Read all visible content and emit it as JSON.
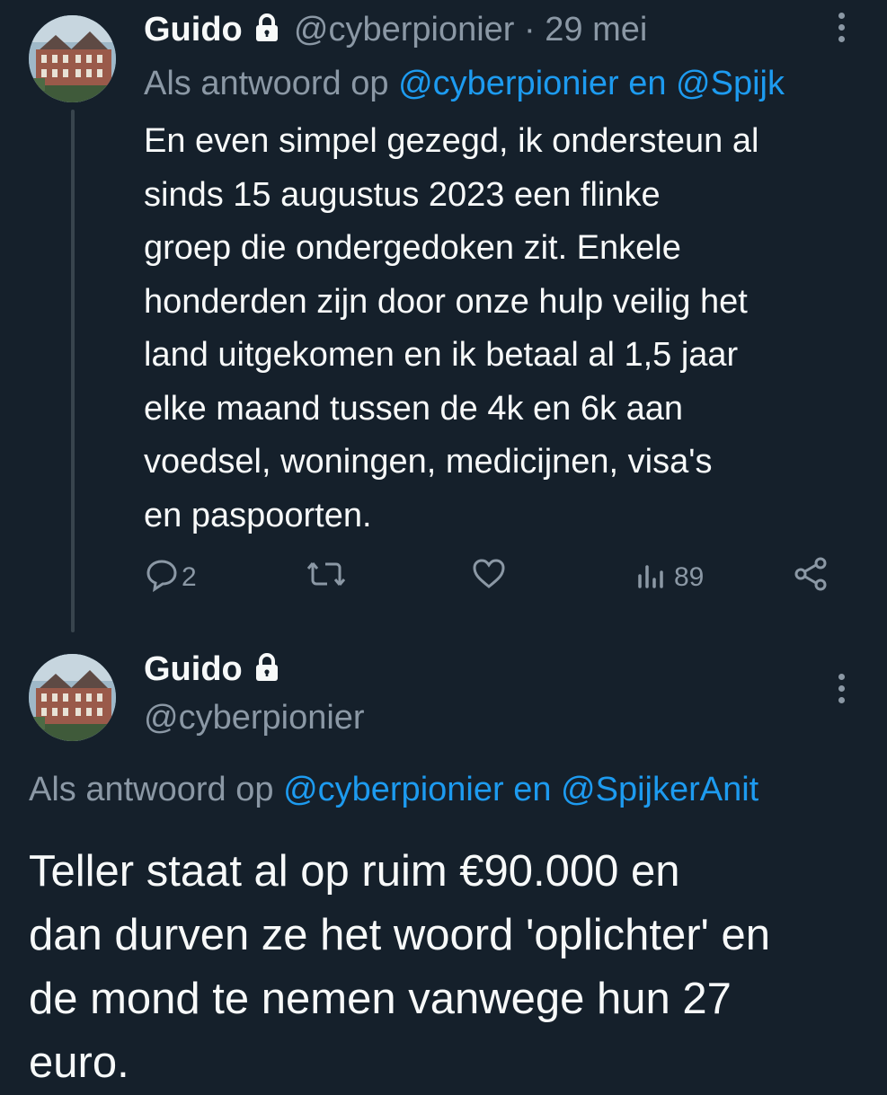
{
  "tweet1": {
    "name": "Guido",
    "handle": "@cyberpionier",
    "dot": "·",
    "date": "29 mei",
    "reply_prefix": "Als antwoord op",
    "reply_to": "@cyberpionier en @Spijk",
    "text": "En even simpel gezegd, ik ondersteun al\nsinds 15 augustus 2023 een flinke\ngroep die ondergedoken zit. Enkele\nhonderden zijn door onze hulp veilig het\nland uitgekomen en ik betaal al 1,5 jaar\nelke maand tussen de 4k en 6k aan\nvoedsel, woningen, medicijnen, visa's\nen paspoorten.",
    "actions": {
      "reply_count": "2",
      "retweet_count": "",
      "like_count": "",
      "views_count": "89"
    }
  },
  "tweet2": {
    "name": "Guido",
    "handle": "@cyberpionier",
    "reply_prefix": "Als antwoord op",
    "reply_to": "@cyberpionier en @SpijkerAnit",
    "text": "Teller staat al op ruim €90.000 en\ndan durven ze het woord 'oplichter' en\nde mond te nemen vanwege hun 27\neuro."
  },
  "icons": {
    "lock": "lock-icon",
    "more": "more-options-icon",
    "reply": "reply-icon",
    "retweet": "retweet-icon",
    "like": "heart-icon",
    "views": "views-icon",
    "share": "share-icon"
  },
  "colors": {
    "background": "#15202b",
    "text": "#f7f9f9",
    "muted": "#8b98a5",
    "link": "#1d9bf0",
    "thread_line": "#38444d"
  }
}
